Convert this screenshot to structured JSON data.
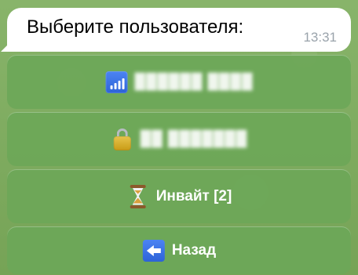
{
  "message": {
    "text": "Выберите пользователя:",
    "time": "13:31"
  },
  "keyboard": {
    "buttons": [
      {
        "label": "██████ ████",
        "icon": "signal-icon"
      },
      {
        "label": "██ ███████",
        "icon": "lock-icon"
      },
      {
        "label": "Инвайт [2]",
        "icon": "hourglass-icon"
      },
      {
        "label": "Назад",
        "icon": "back-arrow-icon"
      }
    ]
  },
  "colors": {
    "background": "#7fad5f",
    "button": "#6da758",
    "bubble": "#ffffff",
    "time": "#9aa3ab",
    "text": "#000000"
  }
}
